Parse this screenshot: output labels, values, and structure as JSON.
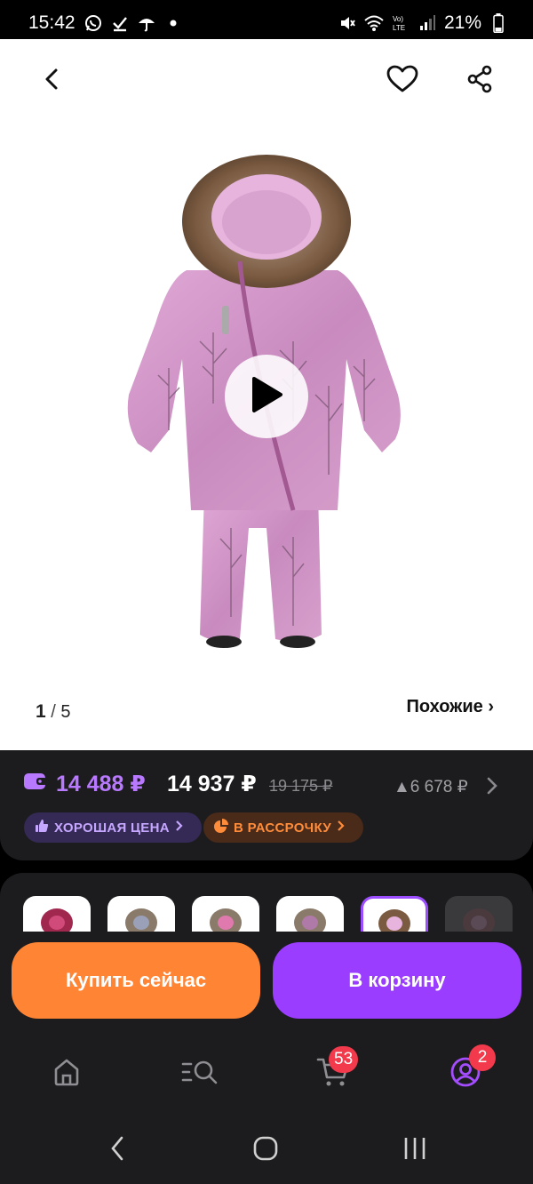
{
  "status_bar": {
    "time": "15:42",
    "battery": "21%",
    "left_icons": [
      "whatsapp-icon",
      "download-icon",
      "umbrella-icon",
      "dot-icon"
    ],
    "right_icons": [
      "mute-icon",
      "wifi-icon",
      "volte-icon",
      "signal-icon",
      "battery-icon"
    ]
  },
  "header": {
    "icons": [
      "back-arrow-icon",
      "heart-icon",
      "share-icon"
    ]
  },
  "gallery": {
    "current": "1",
    "separator": "/",
    "total": "5",
    "similar_label": "Похожие ›"
  },
  "price": {
    "wallet_price": "14 488 ₽",
    "price": "14 937 ₽",
    "old_price": "19 175 ₽",
    "other_offer": "▲6 678 ₽",
    "badges": [
      {
        "label": "ХОРОШАЯ ЦЕНА",
        "icon": "thumbs-up-icon",
        "color": "#c6a7ff"
      },
      {
        "label": "В РАССРОЧКУ",
        "icon": "pie-chart-icon",
        "color": "#ff8c3a"
      }
    ]
  },
  "actions": {
    "buy_now": "Купить сейчас",
    "add_to_cart": "В корзину"
  },
  "bottom_nav": {
    "items": [
      {
        "icon": "home-icon"
      },
      {
        "icon": "catalog-search-icon"
      },
      {
        "icon": "cart-icon",
        "badge": "53"
      },
      {
        "icon": "profile-icon",
        "badge": "2"
      }
    ]
  },
  "colors": {
    "accent_purple": "#9a3dff",
    "accent_orange": "#ff8534",
    "wallet_price": "#b979ff",
    "badge_red": "#f23a4c"
  }
}
